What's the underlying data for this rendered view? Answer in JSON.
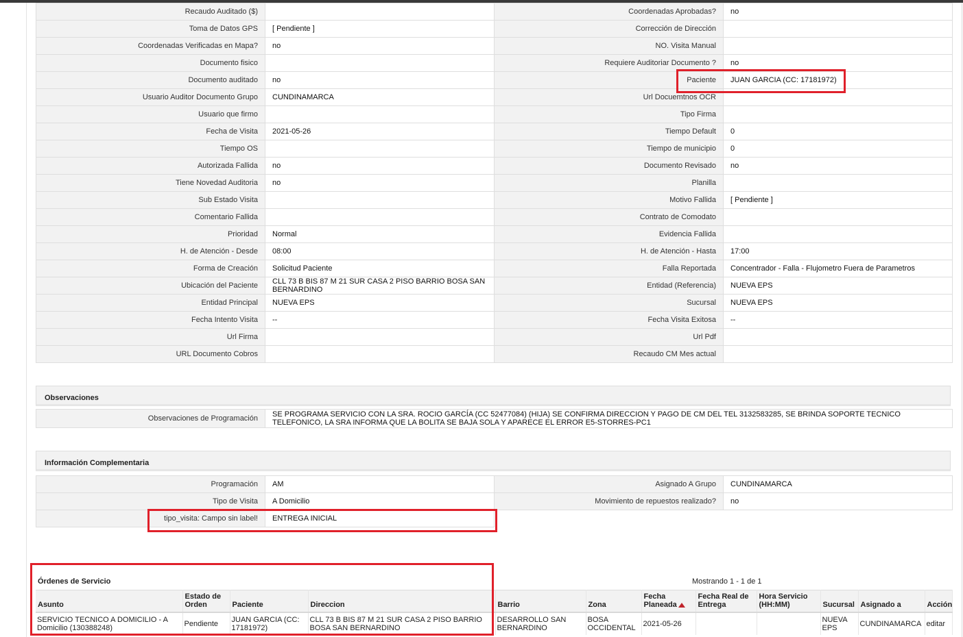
{
  "details": {
    "rows": [
      [
        "Recaudo Auditado ($)",
        "",
        "Coordenadas Aprobadas?",
        "no"
      ],
      [
        "Toma de Datos GPS",
        "[ Pendiente ]",
        "Corrección de Dirección",
        ""
      ],
      [
        "Coordenadas Verificadas en Mapa?",
        "no",
        "NO. Visita Manual",
        ""
      ],
      [
        "Documento fisico",
        "",
        "Requiere Auditoriar Documento ?",
        "no"
      ],
      [
        "Documento auditado",
        "no",
        "Paciente",
        "JUAN GARCIA (CC: 17181972)"
      ],
      [
        "Usuario Auditor Documento Grupo",
        "CUNDINAMARCA",
        "Url Docuemtnos OCR",
        ""
      ],
      [
        "Usuario que firmo",
        "",
        "Tipo Firma",
        ""
      ],
      [
        "Fecha de Visita",
        "2021-05-26",
        "Tiempo Default",
        "0"
      ],
      [
        "Tiempo OS",
        "",
        "Tiempo de municipio",
        "0"
      ],
      [
        "Autorizada Fallida",
        "no",
        "Documento Revisado",
        "no"
      ],
      [
        "Tiene Novedad Auditoria",
        "no",
        "Planilla",
        ""
      ],
      [
        "Sub Estado Visita",
        "",
        "Motivo Fallida",
        "[ Pendiente ]"
      ],
      [
        "Comentario Fallida",
        "",
        "Contrato de Comodato",
        ""
      ],
      [
        "Prioridad",
        "Normal",
        "Evidencia Fallida",
        ""
      ],
      [
        "H. de Atención - Desde",
        "08:00",
        "H. de Atención - Hasta",
        "17:00"
      ],
      [
        "Forma de Creación",
        "Solicitud Paciente",
        "Falla Reportada",
        "Concentrador - Falla - Flujometro Fuera de Parametros"
      ],
      [
        "Ubicación del Paciente",
        "CLL 73 B BIS 87 M 21 SUR CASA 2 PISO BARRIO BOSA SAN BERNARDINO",
        "Entidad (Referencia)",
        "NUEVA EPS"
      ],
      [
        "Entidad Principal",
        "NUEVA EPS",
        "Sucursal",
        "NUEVA EPS"
      ],
      [
        "Fecha Intento Visita",
        "--",
        "Fecha Visita Exitosa",
        "--"
      ],
      [
        "Url Firma",
        "",
        "Url Pdf",
        ""
      ],
      [
        "URL Documento Cobros",
        "",
        "Recaudo CM Mes actual",
        ""
      ]
    ]
  },
  "observaciones": {
    "title": "Observaciones",
    "label": "Observaciones de Programación",
    "value": "  SE PROGRAMA SERVICIO CON LA SRA. ROCIO GARCÍA (CC 52477084) (HIJA) SE CONFIRMA DIRECCION Y PAGO DE CM DEL TEL 3132583285, SE BRINDA SOPORTE TECNICO TELEFONICO, LA SRA INFORMA QUE LA BOLITA SE BAJA SOLA Y APARECE EL ERROR E5-STORRES-PC1"
  },
  "complementaria": {
    "title": "Información Complementaria",
    "rows": [
      [
        "Programación",
        "AM",
        "Asignado A Grupo",
        "CUNDINAMARCA"
      ],
      [
        "Tipo de Visita",
        "A Domicilio",
        "Movimiento de repuestos realizado?",
        "no"
      ]
    ],
    "extra_label": "tipo_visita: Campo sin label!",
    "extra_value": "ENTREGA INICIAL"
  },
  "ordenes": {
    "title": "Órdenes de Servicio",
    "count": "Mostrando 1 - 1 de 1",
    "headers": [
      "Asunto",
      "Estado de Orden",
      "Paciente",
      "Direccion",
      "Barrio",
      "Zona",
      "Fecha Planeada",
      "Fecha Real de Entrega",
      "Hora Servicio (HH:MM)",
      "Sucursal",
      "Asignado a",
      "Acción"
    ],
    "row": {
      "asunto": "SERVICIO TECNICO A DOMICILIO - A Domicilio (130388248)",
      "estado": "Pendiente",
      "paciente": "JUAN GARCIA (CC: 17181972)",
      "direccion": "CLL 73 B BIS 87 M 21 SUR CASA 2 PISO BARRIO BOSA SAN BERNARDINO",
      "barrio": "DESARROLLO SAN BERNARDINO",
      "zona": "BOSA OCCIDENTAL",
      "fecha_planeada": "2021-05-26",
      "fecha_real": "",
      "hora_servicio": "",
      "sucursal": "NUEVA EPS",
      "asignado": "CUNDINAMARCA",
      "accion": "editar"
    }
  },
  "colors": {
    "highlight": "#e0202a",
    "label_bg": "#f2f2f2",
    "border": "#dedede"
  }
}
